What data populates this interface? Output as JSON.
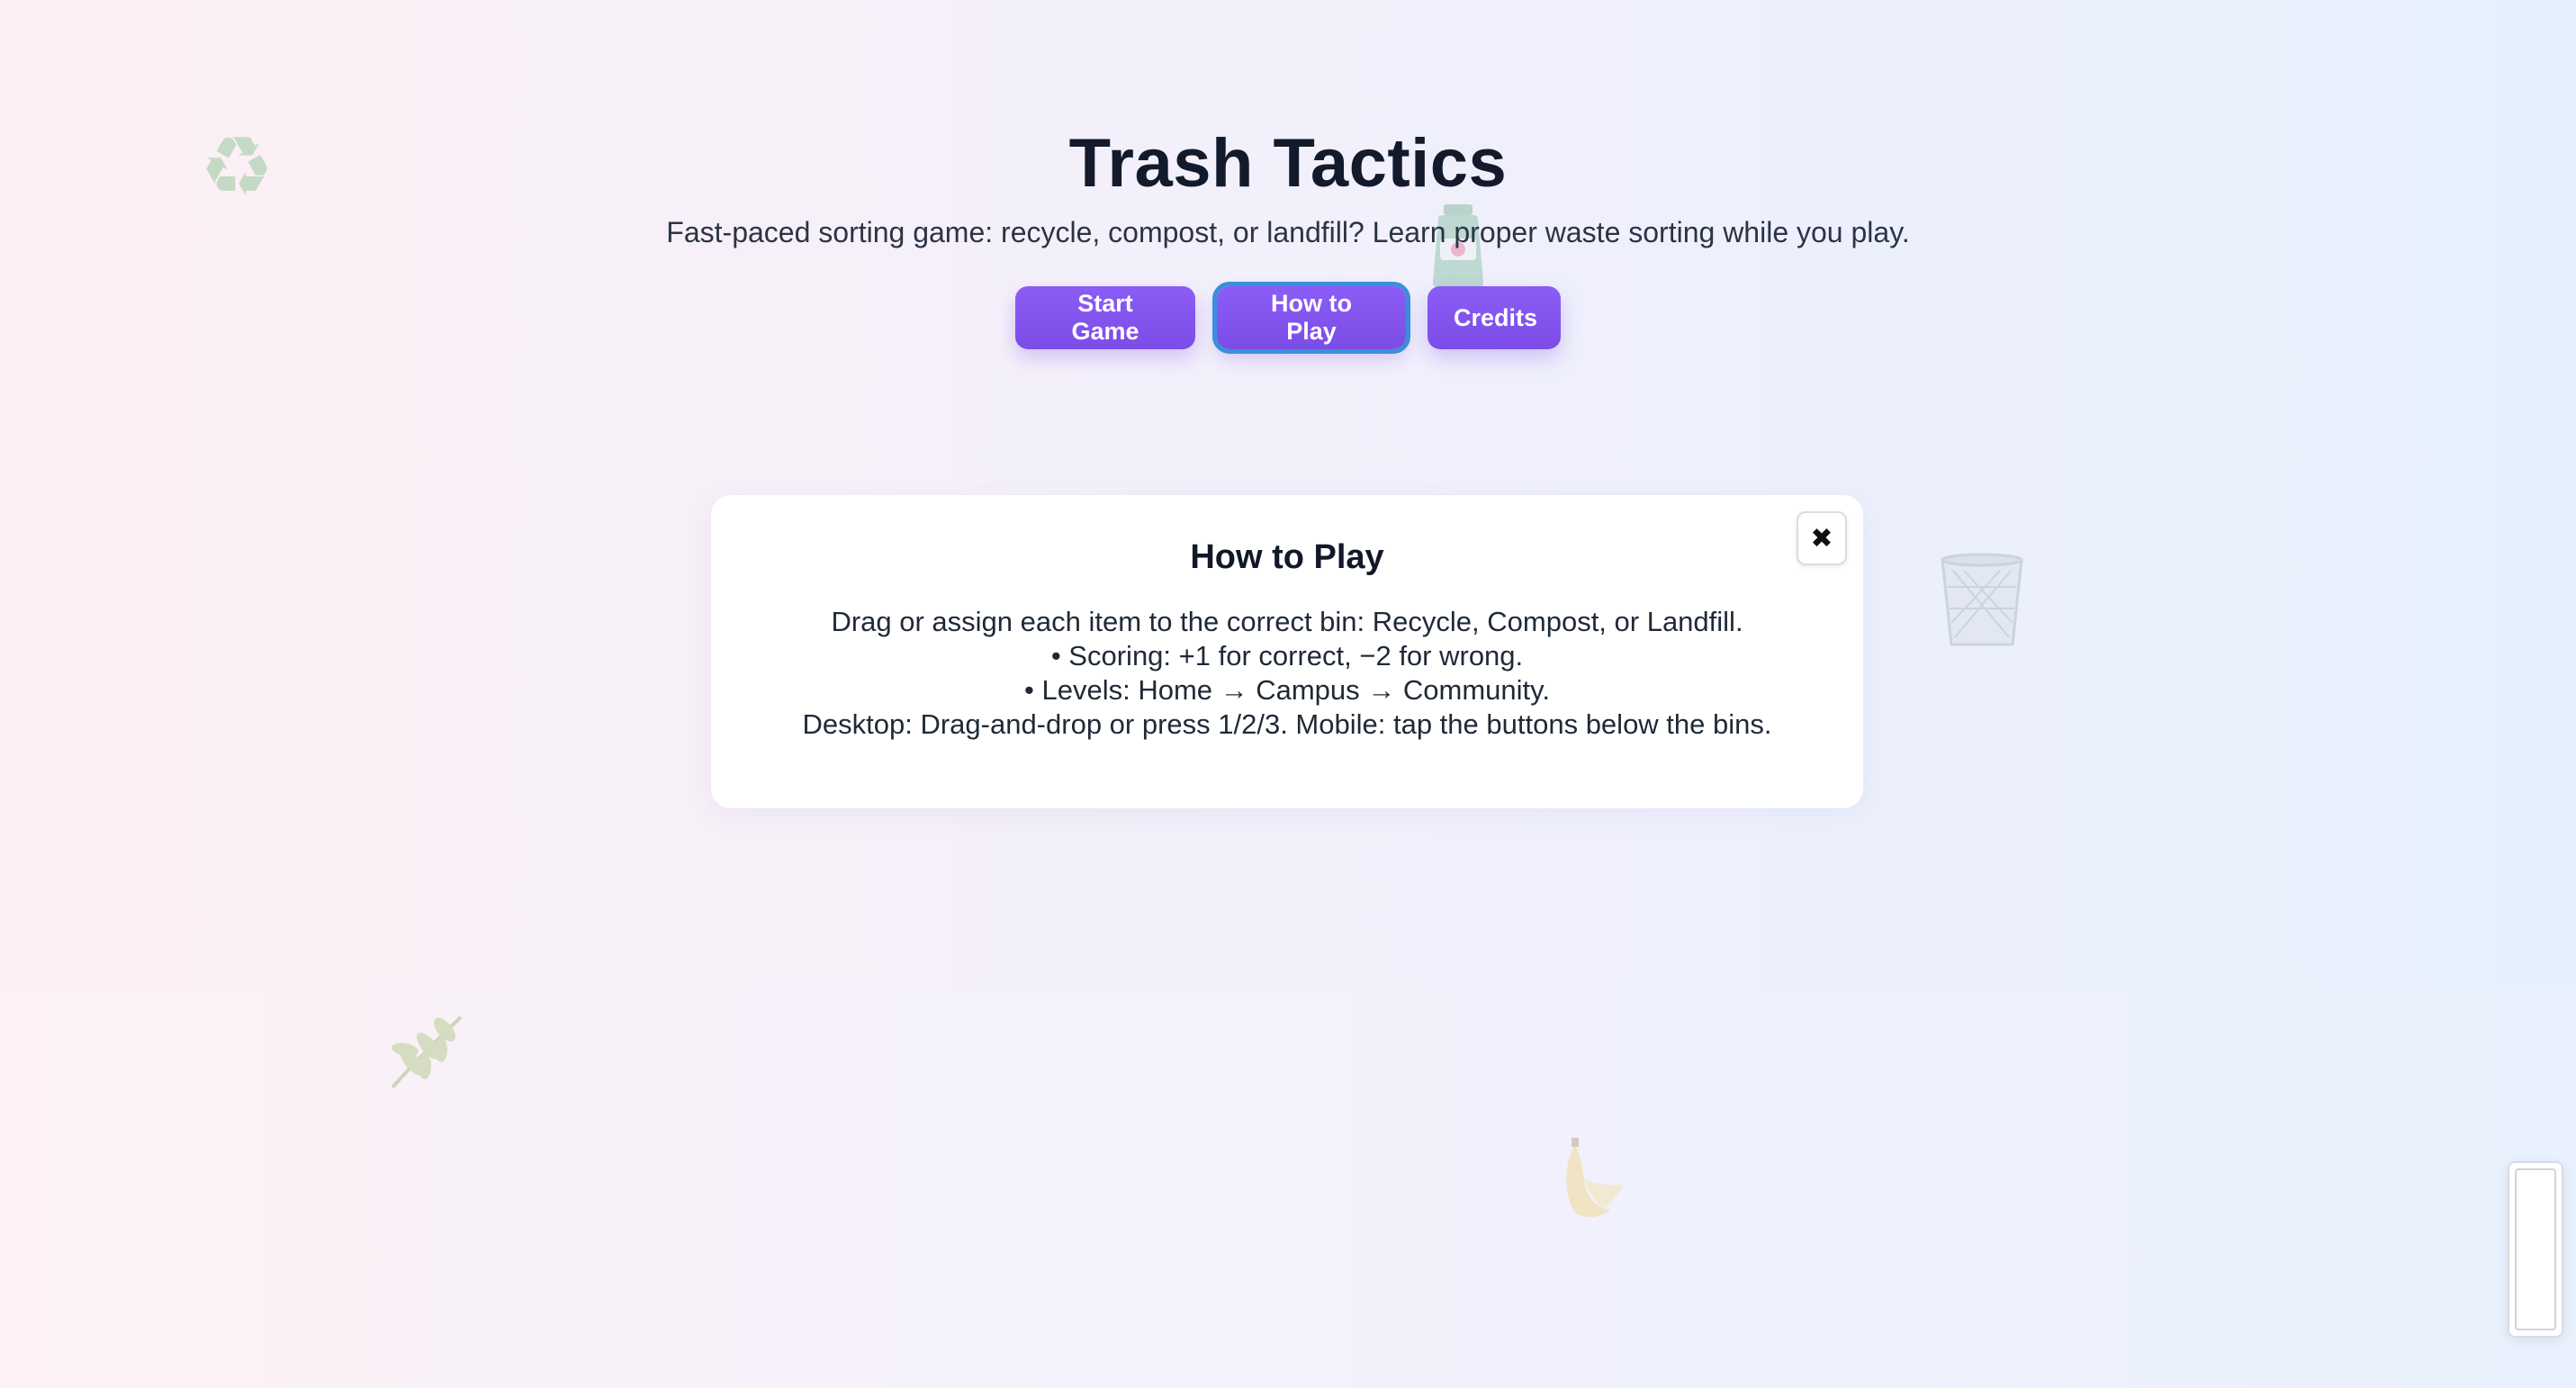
{
  "game": {
    "title": "Trash Tactics",
    "subtitle": "Fast-paced sorting game: recycle, compost, or landfill? Learn proper waste sorting while you play."
  },
  "menu": {
    "start_label": "Start Game",
    "how_label": "How to Play",
    "credits_label": "Credits"
  },
  "modal": {
    "title": "How to Play",
    "close_label": "✖",
    "lines": [
      "Drag or assign each item to the correct bin: Recycle, Compost, or Landfill.",
      "• Scoring: +1 for correct, −2 for wrong.",
      "• Levels: Home → Campus → Community.",
      "Desktop: Drag-and-drop or press 1/2/3. Mobile: tap the buttons below the bins."
    ]
  },
  "decorations": {
    "recycle_glyph": "♻",
    "items": [
      "recycle-icon",
      "bottle-icon",
      "trash-bin-icon",
      "leaf-icon",
      "banana-icon"
    ]
  },
  "colors": {
    "button": "#8b5cf6",
    "focus_ring": "#3b8fd9",
    "title": "#131a2c"
  }
}
